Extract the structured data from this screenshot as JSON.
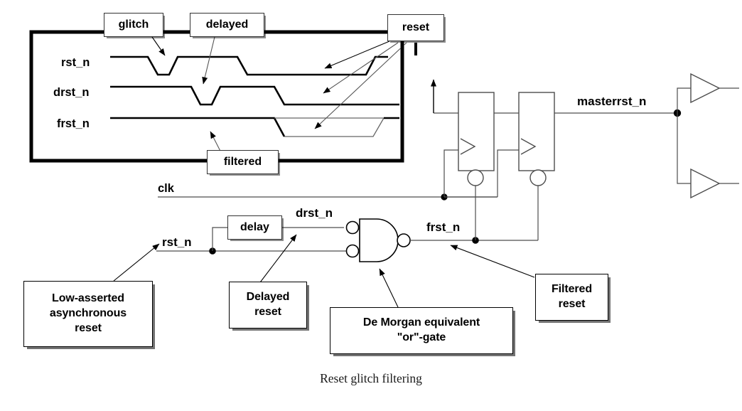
{
  "figure": {
    "caption": "Reset glitch filtering",
    "title": "Reset glitch filtering"
  },
  "timing_diagram": {
    "signals": [
      {
        "name": "rst_n",
        "label": "rst_n"
      },
      {
        "name": "drst_n",
        "label": "drst_n"
      },
      {
        "name": "frst_n",
        "label": "frst_n"
      }
    ],
    "annotations": [
      {
        "id": "glitch",
        "label": "glitch"
      },
      {
        "id": "delayed",
        "label": "delayed"
      },
      {
        "id": "reset",
        "label": "reset"
      },
      {
        "id": "filtered",
        "label": "filtered"
      }
    ]
  },
  "schematic": {
    "signal_labels": {
      "clk": "clk",
      "rst_n": "rst_n",
      "drst_n": "drst_n",
      "frst_n": "frst_n",
      "masterrst_n": "masterrst_n"
    },
    "blocks": [
      {
        "id": "delay",
        "label": "delay"
      }
    ],
    "callouts": [
      {
        "id": "low-asserted-async-reset",
        "lines": [
          "Low-asserted",
          "asynchronous",
          "reset"
        ]
      },
      {
        "id": "delayed-reset",
        "lines": [
          "Delayed",
          "reset"
        ]
      },
      {
        "id": "de-morgan-or-gate",
        "lines": [
          "De Morgan equivalent",
          "\"or\"-gate"
        ]
      },
      {
        "id": "filtered-reset",
        "lines": [
          "Filtered",
          "reset"
        ]
      }
    ]
  },
  "colors": {
    "ink": "#000000",
    "thin_wire": "#4d4d4d",
    "background": "#ffffff",
    "shadow": "rgba(0,0,0,0.55)"
  }
}
